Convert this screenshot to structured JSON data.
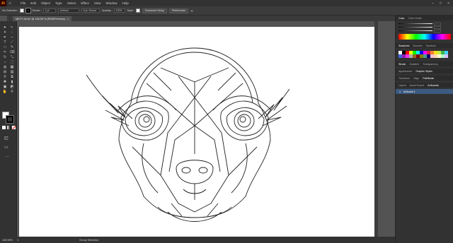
{
  "app": {
    "logo": "Ai",
    "home_icon": "home-icon"
  },
  "menu": [
    "File",
    "Edit",
    "Object",
    "Type",
    "Select",
    "Effect",
    "View",
    "Window",
    "Help"
  ],
  "control_bar": {
    "selection": "No Selection",
    "stroke_label": "Stroke:",
    "stroke_weight": "1 pt",
    "profile": "Uniform",
    "brush": "5 pt. Round",
    "opacity_label": "Opacity:",
    "opacity_value": "100%",
    "style_label": "Style:",
    "doc_setup": "Document Setup",
    "preferences": "Preferences"
  },
  "document_tab": {
    "title": "MEYT A4.ai* @ 136.96 % (RGB/Preview)",
    "close": "×"
  },
  "status": {
    "zoom": "136.96%",
    "artboard": "1",
    "tool": "Group Selection"
  },
  "panels": {
    "color_tabs": [
      "Color",
      "Color Guide"
    ],
    "swatch_tabs": [
      "Swatches",
      "Brushes",
      "Symbols"
    ],
    "stroke_tabs": [
      "Stroke",
      "Gradient",
      "Transparency"
    ],
    "appearance_tabs": [
      "Appearance",
      "Graphic Styles"
    ],
    "transform_tabs": [
      "Transform",
      "Align",
      "Pathfinder"
    ],
    "layer_tabs": [
      "Layers",
      "Asset Export",
      "Artboards"
    ],
    "artboard_row": {
      "index": "1",
      "name": "Artboard 1"
    }
  },
  "colors": {
    "accent": "#3d5a80",
    "swatch_palette": [
      "#ffffff",
      "#000000",
      "#ff0000",
      "#ffff00",
      "#00ff00",
      "#00ffff",
      "#0000ff",
      "#ff00ff",
      "#e6194b",
      "#f58231",
      "#ffe119",
      "#bfef45",
      "#3cb44b",
      "#42d4f4",
      "#4363d8",
      "#911eb4",
      "#f032e6",
      "#a9a9a9",
      "#9a6324",
      "#800000",
      "#808000",
      "#469990",
      "#000075",
      "#fabed4",
      "#ffd8b1",
      "#fffac8",
      "#aaffc3",
      "#dcbeff"
    ]
  }
}
